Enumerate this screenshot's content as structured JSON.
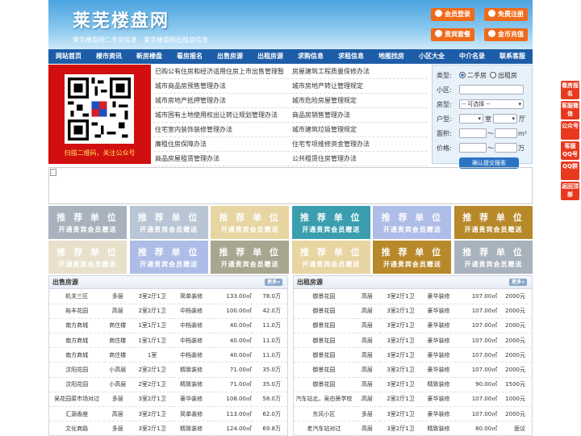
{
  "header": {
    "logo": "莱芜楼盘网",
    "subtitle": "莱芜楼盘网二手房信息　莱芜楼盘网出租房信息",
    "buttons": [
      "会员登录",
      "免费注册",
      "贵宾套餐",
      "金币充值"
    ]
  },
  "nav": [
    "网站首页",
    "楼市资讯",
    "新房楼盘",
    "看房报名",
    "出售房源",
    "出租房源",
    "求购信息",
    "求租信息",
    "地图找房",
    "小区大全",
    "中介名录",
    "联系客服"
  ],
  "qr": {
    "caption": "扫描二维码，关注公众号"
  },
  "links": [
    [
      "已购公有住房和经济适用住房上市出售管理暂",
      "房屋建筑工程质量保修办法"
    ],
    [
      "城市商品房预售管理办法",
      "城市房地产转让管理规定"
    ],
    [
      "城市房地产抵押管理办法",
      "城市危险房屋管理规定"
    ],
    [
      "城市国有土地使用权出让转让规划管理办法",
      "商品房销售管理办法"
    ],
    [
      "住宅室内装饰装修管理办法",
      "城市建筑垃圾管理规定"
    ],
    [
      "廉租住房保障办法",
      "住宅专项维修资金管理办法"
    ],
    [
      "商品房屋租赁管理办法",
      "公共租赁住房管理办法"
    ]
  ],
  "search": {
    "type_label": "类型:",
    "type_options": [
      "二手房",
      "出租房"
    ],
    "community_label": "小区:",
    "house_type_label": "房型:",
    "house_type_value": "-- 可选择 --",
    "layout_label": "户型:",
    "room_unit": "室",
    "hall_unit": "厅",
    "area_label": "面积:",
    "area_sep": "～",
    "area_unit": "m²",
    "price_label": "价格:",
    "price_sep": "～",
    "price_unit": "万",
    "submit": "确认提交搜索"
  },
  "tiles": {
    "line1": "推 荐 单 位",
    "line2": "开通贵宾会员赠送",
    "colors": [
      "#a7b2bc",
      "#b7c5d4",
      "#e7d5a2",
      "#3a9eaf",
      "#aebde8",
      "#b8892a",
      "#e9e0cc",
      "#aebde8",
      "#a9a690",
      "#e7d5a2",
      "#b8892a",
      "#a7b2bc"
    ]
  },
  "sale": {
    "title": "出售房源",
    "more": "更多»",
    "rows": [
      [
        "机关三区",
        "多层",
        "3室2厅1卫",
        "简单装修",
        "133.00㎡",
        "78.0万"
      ],
      [
        "裕丰花园",
        "高层",
        "2室2厅1卫",
        "中档装修",
        "100.00㎡",
        "42.0万"
      ],
      [
        "南方商城",
        "商住楼",
        "1室1厅1卫",
        "中档装修",
        "40.00㎡",
        "11.0万"
      ],
      [
        "南方商城",
        "商住楼",
        "1室1厅1卫",
        "中档装修",
        "40.00㎡",
        "11.0万"
      ],
      [
        "南方商城",
        "商住楼",
        "1室",
        "中档装修",
        "40.00㎡",
        "11.0万"
      ],
      [
        "汶阳花园",
        "小高层",
        "2室2厅1卫",
        "精致装修",
        "71.00㎡",
        "35.0万"
      ],
      [
        "汶阳花园",
        "小高层",
        "2室2厅1卫",
        "精致装修",
        "71.00㎡",
        "35.0万"
      ],
      [
        "吴花园菜市场对过",
        "多层",
        "3室2厅1卫",
        "豪华装修",
        "108.00㎡",
        "58.0万"
      ],
      [
        "汇源香座",
        "高层",
        "3室2厅1卫",
        "简单装修",
        "113.00㎡",
        "62.0万"
      ],
      [
        "文化商路",
        "多层",
        "3室2厅1卫",
        "精致装修",
        "124.00㎡",
        "69.8万"
      ]
    ]
  },
  "rent": {
    "title": "出租房源",
    "more": "更多»",
    "rows": [
      [
        "御景花园",
        "高层",
        "3室2厅1卫",
        "豪华装修",
        "107.00㎡",
        "2000元"
      ],
      [
        "御景花园",
        "高层",
        "3室2厅1卫",
        "豪华装修",
        "107.00㎡",
        "2000元"
      ],
      [
        "御景花园",
        "高层",
        "3室2厅1卫",
        "豪华装修",
        "107.00㎡",
        "2000元"
      ],
      [
        "御景花园",
        "高层",
        "3室2厅1卫",
        "豪华装修",
        "107.00㎡",
        "2000元"
      ],
      [
        "御景花园",
        "高层",
        "3室2厅1卫",
        "豪华装修",
        "107.00㎡",
        "2000元"
      ],
      [
        "御景花园",
        "高层",
        "3室2厅1卫",
        "豪华装修",
        "107.00㎡",
        "2000元"
      ],
      [
        "御景花园",
        "高层",
        "3室2厅1卫",
        "精致装修",
        "90.00㎡",
        "1500元"
      ],
      [
        "汽车站北，吴伯箫学校",
        "高层",
        "2室2厅1卫",
        "豪华装修",
        "107.00㎡",
        "1000元"
      ],
      [
        "东风小区",
        "多层",
        "3室2厅1卫",
        "豪华装修",
        "107.00㎡",
        "2000元"
      ],
      [
        "老汽车站对过",
        "高层",
        "3室2厅1卫",
        "精致装修",
        "80.00㎡",
        "面议"
      ]
    ]
  },
  "float": [
    "看房报名",
    "客服微信",
    "公众号",
    "客服QQ号",
    "QQ群",
    "返回顶部"
  ]
}
